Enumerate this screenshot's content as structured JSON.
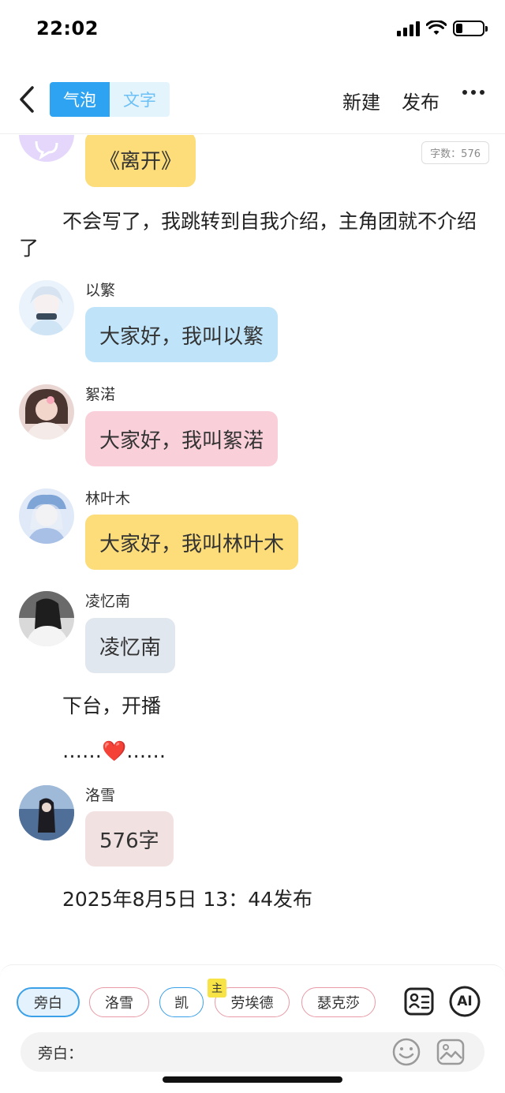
{
  "status_bar": {
    "time": "22:02",
    "battery_percent": 25
  },
  "nav": {
    "tabs": [
      {
        "label": "气泡",
        "active": true
      },
      {
        "label": "文字",
        "active": false
      }
    ],
    "new_label": "新建",
    "publish_label": "发布"
  },
  "word_count": "字数：576",
  "top_bubble": {
    "text": "《离开》",
    "color": "#fcdd7a"
  },
  "narration_1": "不会写了，我跳转到自我介绍，主角团就不介绍了",
  "messages": [
    {
      "speaker": "以繁",
      "text": "大家好，我叫以繁",
      "color": "#bfe4fa"
    },
    {
      "speaker": "絮渃",
      "text": "大家好，我叫絮渃",
      "color": "#f9d0da"
    },
    {
      "speaker": "林叶木",
      "text": "大家好，我叫林叶木",
      "color": "#fcdd7a"
    },
    {
      "speaker": "凌忆南",
      "text": "凌忆南",
      "color": "#e1e7ef"
    }
  ],
  "narration_2": "下台，开播",
  "narration_3": "……❤️……",
  "message_5": {
    "speaker": "洛雪",
    "text": "576字",
    "color": "#f1e1e1"
  },
  "narration_4": "2025年8月5日 13：44发布",
  "bottom": {
    "chips": [
      {
        "label": "旁白",
        "selected": true,
        "color": "#3aa0e8",
        "badge": ""
      },
      {
        "label": "洛雪",
        "selected": false,
        "color": "#e89aa6",
        "badge": ""
      },
      {
        "label": "凯",
        "selected": false,
        "color": "#3aa0e8",
        "badge": ""
      },
      {
        "label": "劳埃德",
        "selected": false,
        "color": "#e89aa6",
        "badge": "主"
      },
      {
        "label": "瑟克莎",
        "selected": false,
        "color": "#e89aa6",
        "badge": ""
      }
    ],
    "ai_label": "AI",
    "input_label": "旁白："
  },
  "icons": [
    "back-arrow",
    "more-dots",
    "contact-card",
    "ai-circle",
    "smile-emoji",
    "image-picture"
  ]
}
